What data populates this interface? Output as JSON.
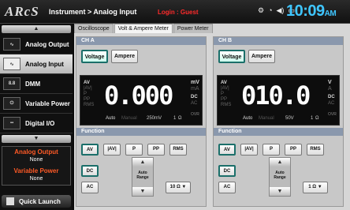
{
  "header": {
    "logo": "ARcS",
    "title": "Instrument > Analog Input",
    "login": "Login : Guest",
    "time": "10:09",
    "ampm": "AM"
  },
  "sidebar": {
    "items": [
      {
        "label": "Analog Output",
        "icon": "waveform-icon"
      },
      {
        "label": "Analog Input",
        "icon": "waveform-in-icon"
      },
      {
        "label": "DMM",
        "icon": "dmm-icon"
      },
      {
        "label": "Variable Power",
        "icon": "power-icon"
      },
      {
        "label": "Digital I/O",
        "icon": "dio-icon"
      }
    ],
    "analog_output_label": "Analog Output",
    "analog_output_value": "None",
    "variable_power_label": "Variable Power",
    "variable_power_value": "None",
    "quick_launch": "Quick Launch"
  },
  "tabs": [
    "Oscilloscope",
    "Volt & Ampere Meter",
    "Power Meter"
  ],
  "channels": {
    "a": {
      "title": "CH A",
      "mode_voltage": "Voltage",
      "mode_ampere": "Ampere",
      "reading": "0.000",
      "unit_main": "mV",
      "unit_sub": "mA",
      "left_labels": [
        "AV",
        "|AV|",
        "P",
        "PP",
        "RMS"
      ],
      "right_labels": [
        "DC",
        "AC"
      ],
      "auto": "Auto",
      "manual": "Manual",
      "range": "250mV",
      "ohm": "1",
      "ohm_unit": "Ω",
      "ovr": "OVR",
      "function_title": "Function",
      "functions": [
        "AV",
        "|AV|",
        "P",
        "PP",
        "RMS"
      ],
      "dc": "DC",
      "ac": "AC",
      "auto_range": "Auto Range",
      "ohm_select": "10 Ω ▼"
    },
    "b": {
      "title": "CH B",
      "mode_voltage": "Voltage",
      "mode_ampere": "Ampere",
      "reading": "010.0",
      "unit_main": "V",
      "unit_sub": "A",
      "left_labels": [
        "AV",
        "|AV|",
        "P",
        "PP",
        "RMS"
      ],
      "right_labels": [
        "DC",
        "AC"
      ],
      "auto": "Auto",
      "manual": "Manual",
      "range": "50V",
      "ohm": "1",
      "ohm_unit": "Ω",
      "ovr": "OVR",
      "function_title": "Function",
      "functions": [
        "AV",
        "|AV|",
        "P",
        "PP",
        "RMS"
      ],
      "dc": "DC",
      "ac": "AC",
      "auto_range": "Auto Range",
      "ohm_select": "1 Ω ▼"
    }
  },
  "colors": {
    "accent": "#1b6f6a",
    "clock": "#3fc6ff",
    "login": "#ff2a2a",
    "status": "#ff5a26",
    "header": "#8a98ad"
  }
}
